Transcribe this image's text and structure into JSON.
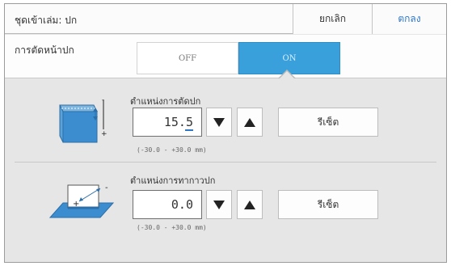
{
  "header": {
    "title": "ชุดเข้าเล่ม: ปก",
    "cancel_label": "ยกเลิก",
    "ok_label": "ตกลง"
  },
  "trim": {
    "label": "การตัดหน้าปก",
    "off_label": "OFF",
    "on_label": "ON",
    "selected": "ON"
  },
  "cut_position": {
    "title": "ตำแหน่งการตัดปก",
    "value": "15.5",
    "reset_label": "รีเซ็ต",
    "range": "(-30.0 - +30.0 mm)",
    "icon": "cover-cut-position-icon"
  },
  "glue_position": {
    "title": "ตำแหน่งการทากาวปก",
    "value": "0.0",
    "reset_label": "รีเซ็ต",
    "range": "(-30.0 - +30.0 mm)",
    "icon": "glue-position-icon"
  },
  "colors": {
    "accent": "#3aa0dc",
    "ok_text": "#2e77c8"
  }
}
